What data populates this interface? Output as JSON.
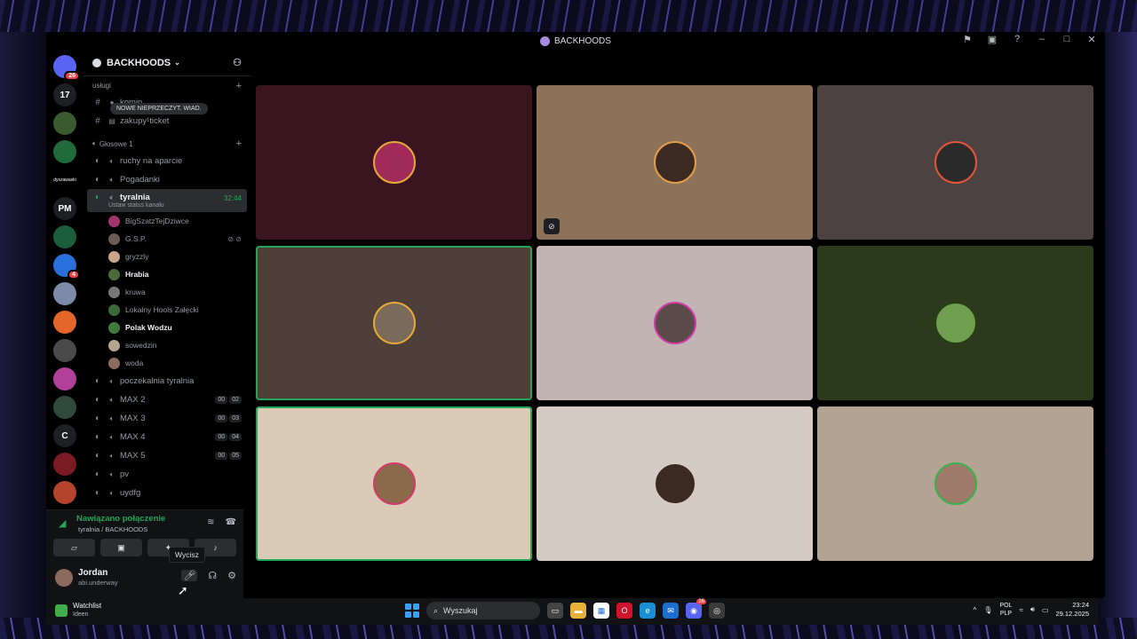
{
  "window": {
    "title": "BACKHOODS"
  },
  "rail": {
    "servers": [
      {
        "label": "",
        "badge": "26",
        "color": "#5865f2"
      },
      {
        "label": "17",
        "badge": "",
        "color": "#1e1f22"
      },
      {
        "label": "",
        "badge": "",
        "color": "#3a5a2f"
      },
      {
        "label": "",
        "badge": "",
        "color": "#1f6b3a"
      },
      {
        "label": "dyszawaski",
        "badge": "",
        "color": "#000000"
      },
      {
        "label": "PM",
        "badge": "",
        "color": "#1e1f22"
      },
      {
        "label": "",
        "badge": "",
        "color": "#1b5e3b"
      },
      {
        "label": "",
        "badge": "4",
        "color": "#2a6fdb"
      },
      {
        "label": "",
        "badge": "",
        "color": "#7d8aa8"
      },
      {
        "label": "",
        "badge": "",
        "color": "#e4662a"
      },
      {
        "label": "",
        "badge": "",
        "color": "#4a4a4a"
      },
      {
        "label": "",
        "badge": "",
        "color": "#b0409a"
      },
      {
        "label": "",
        "badge": "",
        "color": "#2f4a3a"
      },
      {
        "label": "C",
        "badge": "",
        "color": "#1e1f22"
      },
      {
        "label": "",
        "badge": "",
        "color": "#7a1a22"
      },
      {
        "label": "",
        "badge": "",
        "color": "#b3432a"
      },
      {
        "label": "",
        "badge": "",
        "color": "#5a5a5a"
      }
    ],
    "new_label": "NOWE"
  },
  "sidebar": {
    "guild_name": "BACKHOODS",
    "tooltip": "NOWE NIEPRZECZYT. WIAD.",
    "category_uslugi": "usługi",
    "text_channels": [
      {
        "name": "komin"
      },
      {
        "name": "zakupy¹ticket"
      }
    ],
    "category_voice": "Głosowe 1",
    "voice_channels_top": [
      {
        "name": "ruchy na aparcie"
      },
      {
        "name": "Pogadanki"
      }
    ],
    "active_channel": {
      "name": "tyralnia",
      "status_text": "Ustaw status kanału",
      "timer": "32:44"
    },
    "members": [
      {
        "name": "BigSzatzTejDziwce",
        "bold": false,
        "icons": "",
        "color": "#a0356a"
      },
      {
        "name": "G.S.P.",
        "bold": false,
        "icons": "⊘ ⊘",
        "color": "#6b5c55"
      },
      {
        "name": "gryzzly",
        "bold": false,
        "icons": "",
        "color": "#c9a48a"
      },
      {
        "name": "Hrabia",
        "bold": true,
        "icons": "",
        "color": "#4a6a3a"
      },
      {
        "name": "kruwa",
        "bold": false,
        "icons": "",
        "color": "#777777"
      },
      {
        "name": "Lokalny Hools Załęcki",
        "bold": false,
        "icons": "",
        "color": "#3a6a3a"
      },
      {
        "name": "Polak Wodzu",
        "bold": true,
        "icons": "",
        "color": "#3f7a3f"
      },
      {
        "name": "sowedzin",
        "bold": false,
        "icons": "",
        "color": "#b4a58e"
      },
      {
        "name": "woda",
        "bold": false,
        "icons": "",
        "color": "#8a6b5d"
      }
    ],
    "voice_channels_bottom": [
      {
        "name": "poczekalnia tyralnia",
        "c1": "",
        "c2": ""
      },
      {
        "name": "MAX 2",
        "c1": "00",
        "c2": "02"
      },
      {
        "name": "MAX 3",
        "c1": "00",
        "c2": "03"
      },
      {
        "name": "MAX 4",
        "c1": "00",
        "c2": "04"
      },
      {
        "name": "MAX 5",
        "c1": "00",
        "c2": "05"
      },
      {
        "name": "pv",
        "c1": "",
        "c2": ""
      },
      {
        "name": "uydfg",
        "c1": "",
        "c2": ""
      }
    ]
  },
  "voice_panel": {
    "status": "Nawiązano połączenie",
    "channel_info": "tyralnia / BACKHOODS"
  },
  "user_panel": {
    "name": "Jordan",
    "tag": "abi.underway",
    "tooltip": "Wycisz"
  },
  "video_tiles": [
    {
      "bg": "#3a1520",
      "ring": "#e5a83a",
      "speaking": false,
      "deafened": false,
      "avatar_color": "#a02a5a"
    },
    {
      "bg": "#8b7259",
      "ring": "#e59c48",
      "speaking": false,
      "deafened": true,
      "avatar_color": "#3a2a22"
    },
    {
      "bg": "#4d4242",
      "ring": "#e0563a",
      "speaking": false,
      "deafened": false,
      "avatar_color": "#2a2a2a"
    },
    {
      "bg": "#4e4038",
      "ring": "#e5a83a",
      "speaking": true,
      "deafened": false,
      "avatar_color": "#7a6a5a"
    },
    {
      "bg": "#c1b4b3",
      "ring": "#d13aa8",
      "speaking": false,
      "deafened": false,
      "avatar_color": "#5a4a4a"
    },
    {
      "bg": "#2a3b1b",
      "ring": "#2a3b1b",
      "speaking": false,
      "deafened": false,
      "avatar_color": "#6fa050"
    },
    {
      "bg": "#d9cbb6",
      "ring": "#d13a6a",
      "speaking": true,
      "deafened": false,
      "avatar_color": "#8a6a4a"
    },
    {
      "bg": "#d5cbc3",
      "ring": "#d5cbc3",
      "speaking": false,
      "deafened": false,
      "avatar_color": "#3a2a22"
    },
    {
      "bg": "#b3a393",
      "ring": "#3ab04a",
      "speaking": false,
      "deafened": false,
      "avatar_color": "#a07a6a"
    }
  ],
  "taskbar": {
    "weather_title": "Watchlist",
    "weather_sub": "Ideen",
    "search_placeholder": "Wyszukaj",
    "apps": [
      {
        "name": "task-view",
        "color": "#444444",
        "glyph": "▭",
        "badge": ""
      },
      {
        "name": "explorer",
        "color": "#e8b23a",
        "glyph": "▬",
        "badge": ""
      },
      {
        "name": "store",
        "color": "#ffffff",
        "glyph": "▦",
        "badge": ""
      },
      {
        "name": "opera",
        "color": "#d0142c",
        "glyph": "O",
        "badge": ""
      },
      {
        "name": "edge",
        "color": "#1b8ed8",
        "glyph": "e",
        "badge": ""
      },
      {
        "name": "outlook",
        "color": "#1e6ed0",
        "glyph": "✉",
        "badge": ""
      },
      {
        "name": "discord",
        "color": "#5865f2",
        "glyph": "◉",
        "badge": "26"
      },
      {
        "name": "chrome",
        "color": "#3a3a3a",
        "glyph": "◎",
        "badge": ""
      }
    ],
    "lang_1": "POL",
    "lang_2": "PLP",
    "time": "23:24",
    "date": "29.12.2025"
  }
}
